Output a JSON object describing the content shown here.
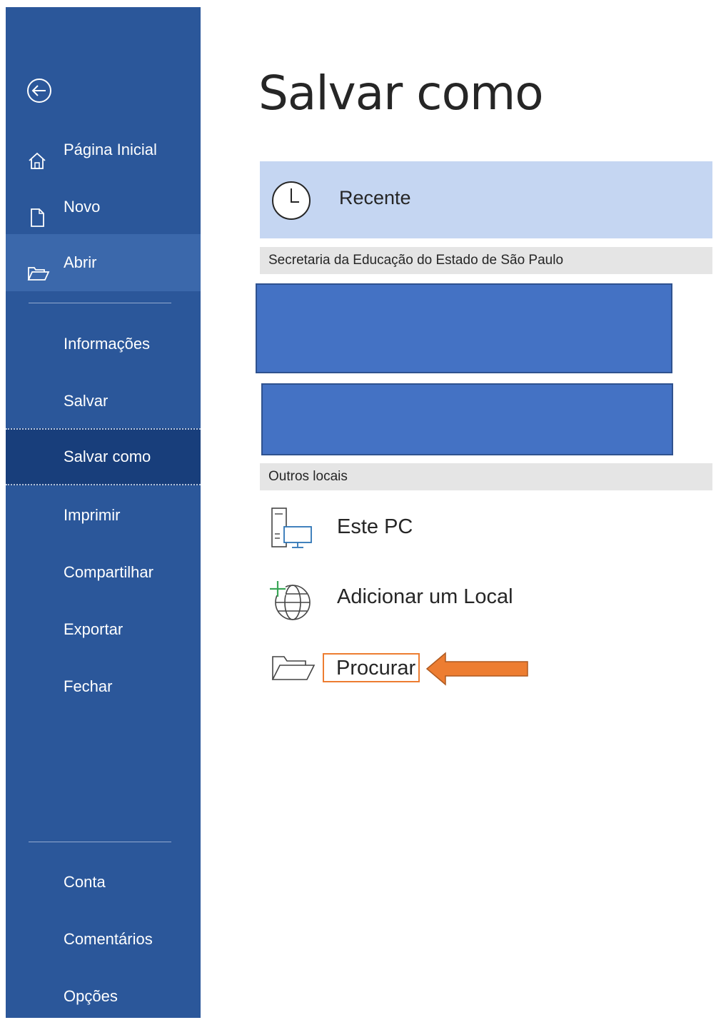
{
  "sidebar": {
    "back_icon": "back-arrow-circle-icon",
    "nav": [
      {
        "label": "Página Inicial",
        "icon": "home-icon"
      },
      {
        "label": "Novo",
        "icon": "new-document-icon"
      },
      {
        "label": "Abrir",
        "icon": "open-folder-icon"
      },
      {
        "label": "Informações"
      },
      {
        "label": "Salvar"
      },
      {
        "label": "Salvar como"
      },
      {
        "label": "Imprimir"
      },
      {
        "label": "Compartilhar"
      },
      {
        "label": "Exportar"
      },
      {
        "label": "Fechar"
      }
    ],
    "footer": [
      {
        "label": "Conta"
      },
      {
        "label": "Comentários"
      },
      {
        "label": "Opções"
      }
    ],
    "selected": "Salvar como"
  },
  "main": {
    "title": "Salvar como",
    "recent": {
      "label": "Recente",
      "icon": "clock-icon"
    },
    "org_section": {
      "label": "Secretaria da Educação do Estado de São Paulo"
    },
    "other_section": {
      "label": "Outros locais"
    },
    "locations": [
      {
        "label": "Este PC",
        "icon": "computer-icon"
      },
      {
        "label": "Adicionar um Local",
        "icon": "add-globe-icon"
      },
      {
        "label": "Procurar",
        "icon": "folder-icon"
      }
    ]
  },
  "colors": {
    "sidebar_bg": "#2b579a",
    "selected_bg": "#183e7b",
    "recent_bg": "#c5d6f2",
    "redaction_block": "#4472c4",
    "highlight_orange": "#ed7d31"
  }
}
